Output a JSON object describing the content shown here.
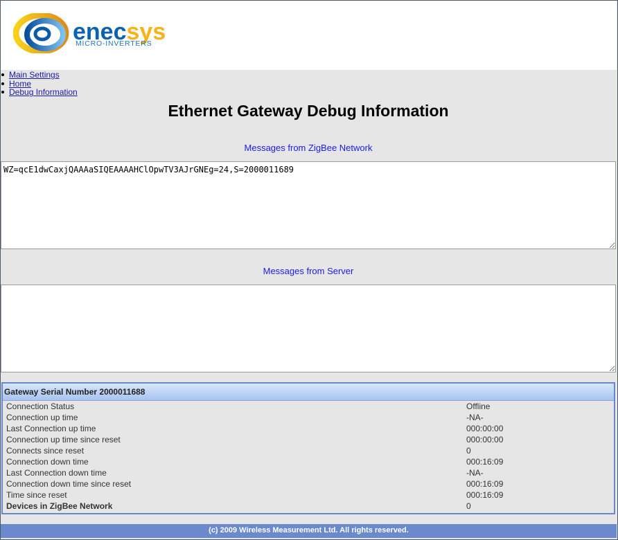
{
  "logo": {
    "brand_left": "enec",
    "brand_right": "sys",
    "tagline": "MICRO-INVERTERS"
  },
  "nav": [
    "Main Settings",
    "Home",
    "Debug Information"
  ],
  "title": "Ethernet Gateway Debug Information",
  "zigbee": {
    "caption": "Messages from ZigBee Network",
    "value": "WZ=qcE1dwCaxjQAAAaSIQEAAAAHClOpwTV3AJrGNEg=24,S=2000011689"
  },
  "server": {
    "caption": "Messages from Server",
    "value": ""
  },
  "gateway": {
    "header": "Gateway Serial Number 2000011688",
    "rows": [
      {
        "label": "Connection Status",
        "value": "Offline"
      },
      {
        "label": "Connection up time",
        "value": "-NA-"
      },
      {
        "label": "Last Connection up time",
        "value": "000:00:00"
      },
      {
        "label": "Connection up time since reset",
        "value": "000:00:00"
      },
      {
        "label": "Connects since reset",
        "value": "0"
      },
      {
        "label": "Connection down time",
        "value": "000:16:09"
      },
      {
        "label": "Last Connection down time",
        "value": "-NA-"
      },
      {
        "label": "Connection down time since reset",
        "value": "000:16:09"
      },
      {
        "label": "Time since reset",
        "value": "000:16:09"
      },
      {
        "label": "Devices in ZigBee Network",
        "value": "0"
      }
    ]
  },
  "footer": "(c) 2009 Wireless Measurement Ltd. All rights reserved."
}
